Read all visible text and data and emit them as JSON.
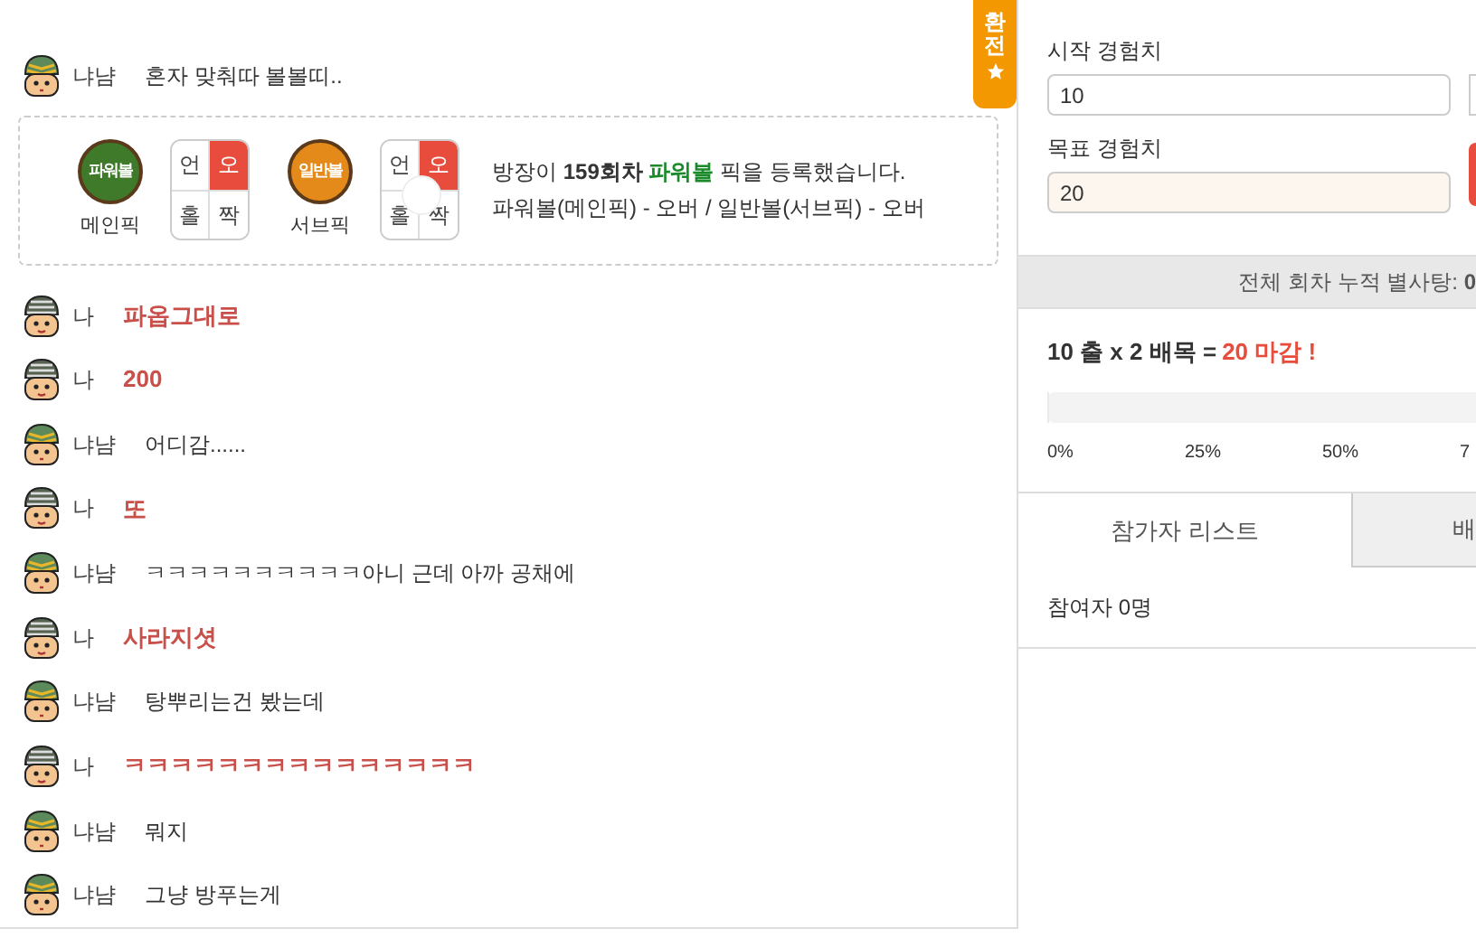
{
  "chat": [
    {
      "kind": "other",
      "name": "냐냠",
      "message": "혼자 맞춰따 볼볼띠.."
    },
    {
      "kind": "pick",
      "picks": [
        {
          "ball": "파워볼",
          "kind": "power",
          "caption": "메인픽",
          "cells": [
            {
              "label": "언",
              "selected": false
            },
            {
              "label": "오",
              "selected": true
            },
            {
              "label": "홀",
              "selected": false
            },
            {
              "label": "짝",
              "selected": false
            }
          ]
        },
        {
          "ball": "일반볼",
          "kind": "normal",
          "caption": "서브픽",
          "cells": [
            {
              "label": "언",
              "selected": false
            },
            {
              "label": "오",
              "selected": true
            },
            {
              "label": "홀",
              "selected": false
            },
            {
              "label": "짝",
              "selected": false
            }
          ]
        }
      ],
      "line1": "방장이 **159회차** ",
      "game": "파워볼",
      "line1_end": " 픽을 등록했습니다.",
      "line2": "파워볼(메인픽) - 오버 / 일반볼(서브픽) - 오버"
    },
    {
      "kind": "me",
      "name": "나",
      "message": "파옵그대로"
    },
    {
      "kind": "me",
      "name": "나",
      "message": "200"
    },
    {
      "kind": "other",
      "name": "냐냠",
      "message": "어디감......"
    },
    {
      "kind": "me",
      "name": "나",
      "message": "또"
    },
    {
      "kind": "other",
      "name": "냐냠",
      "message": "ㅋㅋㅋㅋㅋㅋㅋㅋㅋㅋ아니 근데 아까 공채에"
    },
    {
      "kind": "me",
      "name": "나",
      "message": "사라지셧"
    },
    {
      "kind": "other",
      "name": "냐냠",
      "message": "탕뿌리는건 봤는데"
    },
    {
      "kind": "me",
      "name": "나",
      "message": "ㅋㅋㅋㅋㅋㅋㅋㅋㅋㅋㅋㅋㅋㅋㅋ"
    },
    {
      "kind": "other",
      "name": "냐냠",
      "message": "뭐지"
    },
    {
      "kind": "other",
      "name": "냐냠",
      "message": "그냥 방푸는게"
    }
  ],
  "side_tab": {
    "label": "환전"
  },
  "panel": {
    "start_label": "시작 경험치",
    "start_value": "10",
    "target_label": "목표 경험치",
    "target_value": "20",
    "total": "전체 회차 누적 별사탕: **0**",
    "formula": "10 출 x 2 배목 = ",
    "result": "20 마감 !",
    "progress": {
      "level": 0,
      "ticks": [
        "0%",
        "25%",
        "50%",
        "7"
      ]
    },
    "tabs": [
      {
        "label": "참가자 리스트",
        "selected": true
      },
      {
        "label": "배",
        "selected": false
      }
    ],
    "participants": "참여자 0명"
  }
}
